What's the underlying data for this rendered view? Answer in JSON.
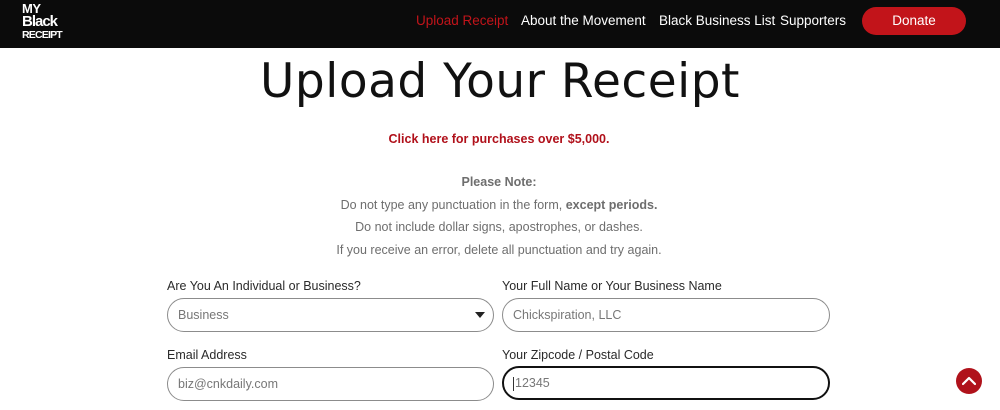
{
  "header": {
    "logo": {
      "line1": "MY",
      "line2": "Black",
      "line3": "RECEIPT"
    },
    "nav": {
      "upload": "Upload Receipt",
      "about": "About the Movement",
      "list": "Black Business List",
      "supporters": "Supporters"
    },
    "donate_label": "Donate",
    "colors": {
      "background": "#0b0b0b",
      "accent": "#c2141a"
    }
  },
  "main": {
    "title": "Upload Your Receipt",
    "purchase_link": "Click here for purchases over $5,000.",
    "note_heading": "Please Note:",
    "note_line1_prefix": "Do not type any punctuation in the form,",
    "note_line1_strong": "except periods.",
    "note_line2": "Do not include dollar signs, apostrophes, or dashes.",
    "note_line3": "If you receive an error, delete all punctuation and try again."
  },
  "form": {
    "type": {
      "label": "Are You An Individual or Business?",
      "value": "Business"
    },
    "name": {
      "label": "Your Full Name or Your Business Name",
      "value": "Chickspiration, LLC"
    },
    "email": {
      "label": "Email Address",
      "value": "biz@cnkdaily.com"
    },
    "zip": {
      "label": "Your Zipcode / Postal Code",
      "value": "12345"
    }
  },
  "scroll_top_icon": "chevron-up-icon"
}
